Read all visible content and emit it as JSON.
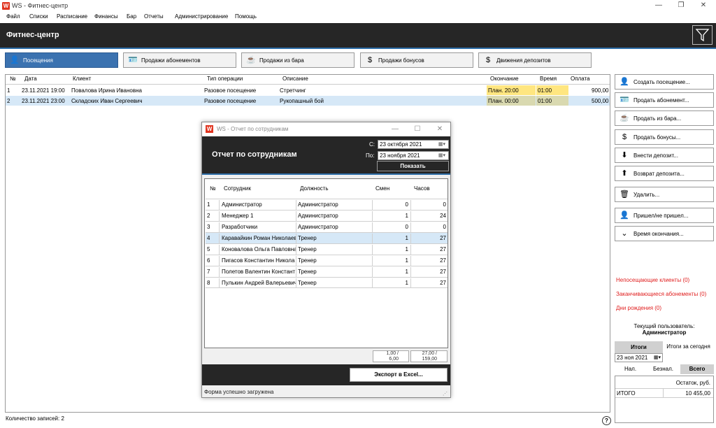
{
  "window": {
    "title": "WS - Фитнес-центр",
    "logo": "W"
  },
  "menu": [
    "Файл",
    "Списки",
    "Расписание",
    "Финансы",
    "Бар",
    "Отчеты",
    "Администрирование",
    "Помощь"
  ],
  "header": {
    "title": "Фитнес-центр"
  },
  "tabs": [
    {
      "label": "Посещения",
      "icon": "person-icon",
      "active": true
    },
    {
      "label": "Продажи абонементов",
      "icon": "card-icon",
      "active": false
    },
    {
      "label": "Продажи из бара",
      "icon": "cup-icon",
      "active": false
    },
    {
      "label": "Продажи бонусов",
      "icon": "dollar-icon",
      "active": false
    },
    {
      "label": "Движения депозитов",
      "icon": "dollar-icon",
      "active": false
    }
  ],
  "grid": {
    "columns": [
      "№",
      "Дата",
      "Клиент",
      "Тип операции",
      "Описание",
      "Окончание",
      "Время",
      "Оплата"
    ],
    "rows": [
      {
        "num": "1",
        "date": "23.11.2021 19:00",
        "client": "Повалова Ирина Ивановна",
        "op": "Разовое посещение",
        "desc": "Стретчинг",
        "end": "План. 20:00",
        "time": "01:00",
        "pay": "900,00"
      },
      {
        "num": "2",
        "date": "23.11.2021 23:00",
        "client": "Складских Иван Сергеевич",
        "op": "Разовое посещение",
        "desc": "Рукопашный бой",
        "end": "План. 00:00",
        "time": "01:00",
        "pay": "500,00"
      }
    ],
    "record_count": "Количество записей: 2"
  },
  "actions": [
    {
      "label": "Создать посещение...",
      "icon": "person-icon"
    },
    {
      "label": "Продать абонемент...",
      "icon": "card-icon"
    },
    {
      "label": "Продать из бара...",
      "icon": "cup-icon"
    },
    {
      "label": "Продать бонусы...",
      "icon": "dollar-icon"
    },
    {
      "label": "Внести депозит...",
      "icon": "deposit-icon"
    },
    {
      "label": "Возврат депозита...",
      "icon": "refund-icon"
    },
    {
      "label": "Удалить...",
      "icon": "trash-icon"
    },
    {
      "label": "Пришел/не пришел...",
      "icon": "person-question-icon"
    },
    {
      "label": "Время окончания...",
      "icon": "chevron-down-icon"
    }
  ],
  "links": [
    "Непосещающие клиенты (0)",
    "Заканчивающиеся абонементы (0)",
    "Дни рождения (0)"
  ],
  "current_user": {
    "label": "Текущий пользователь:",
    "name": "Администратор"
  },
  "totals": {
    "tab_label": "Итоги",
    "today_label": "Итоги за сегодня",
    "date": "23 ноя 2021",
    "pay_tabs": [
      "Нал.",
      "Безнал.",
      "Всего"
    ],
    "balance_header": "Остаток, руб.",
    "row_label": "ИТОГО",
    "row_value": "10 455,00"
  },
  "dialog": {
    "title": "WS - Отчет по сотрудникам",
    "heading": "Отчет по сотрудникам",
    "from_label": "С:",
    "to_label": "По:",
    "from_value": "23 октября  2021",
    "to_value": "23 ноября  2021",
    "show_button": "Показать",
    "columns": [
      "№",
      "Сотрудник",
      "Должность",
      "Смен",
      "Часов"
    ],
    "rows": [
      {
        "num": "1",
        "name": "Администратор",
        "role": "Администратор",
        "shifts": "0",
        "hours": "0"
      },
      {
        "num": "2",
        "name": "Менеджер 1",
        "role": "Администратор",
        "shifts": "1",
        "hours": "24"
      },
      {
        "num": "3",
        "name": "Разработчики",
        "role": "Администратор",
        "shifts": "0",
        "hours": "0"
      },
      {
        "num": "4",
        "name": "Каравайкин Роман Николаев",
        "role": "Тренер",
        "shifts": "1",
        "hours": "27"
      },
      {
        "num": "5",
        "name": "Коновалова Ольга Павловна",
        "role": "Тренер",
        "shifts": "1",
        "hours": "27"
      },
      {
        "num": "6",
        "name": "Пигасов Константин Никола",
        "role": "Тренер",
        "shifts": "1",
        "hours": "27"
      },
      {
        "num": "7",
        "name": "Полетов Валентин Констант",
        "role": "Тренер",
        "shifts": "1",
        "hours": "27"
      },
      {
        "num": "8",
        "name": "Пулькин Андрей Валерьевич",
        "role": "Тренер",
        "shifts": "1",
        "hours": "27"
      }
    ],
    "sum_shifts_1": "1,00 /",
    "sum_shifts_2": "6,00",
    "sum_hours_1": "27,00 /",
    "sum_hours_2": "159,00",
    "export_button": "Экспорт в Excel...",
    "status": "Форма успешно загружена"
  },
  "colors": {
    "header_bg": "#262626",
    "accent": "#3b72b0",
    "highlight": "#ffe680",
    "link_red": "#e02020"
  }
}
